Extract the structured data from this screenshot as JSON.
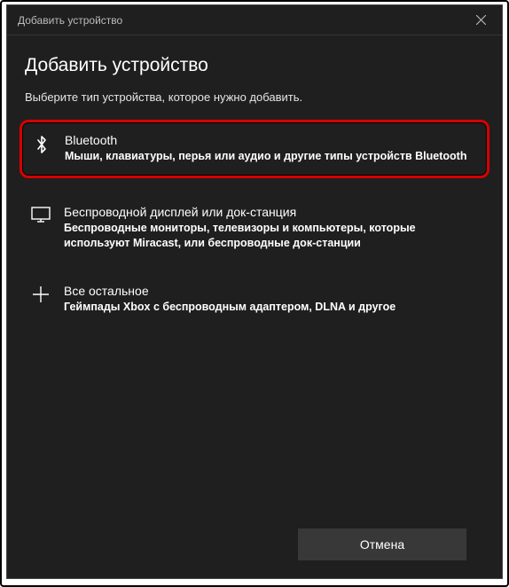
{
  "titlebar": {
    "title": "Добавить устройство"
  },
  "heading": "Добавить устройство",
  "subtext": "Выберите тип устройства, которое нужно добавить.",
  "options": {
    "bluetooth": {
      "title": "Bluetooth",
      "desc": "Мыши, клавиатуры, перья или аудио и другие типы устройств Bluetooth"
    },
    "wireless": {
      "title": "Беспроводной дисплей или док-станция",
      "desc": "Беспроводные мониторы, телевизоры и компьютеры, которые используют Miracast, или беспроводные док-станции"
    },
    "other": {
      "title": "Все остальное",
      "desc": "Геймпады Xbox с беспроводным адаптером, DLNA и другое"
    }
  },
  "buttons": {
    "cancel": "Отмена"
  },
  "colors": {
    "highlight": "#d90000",
    "bg": "#1f1f1f"
  }
}
